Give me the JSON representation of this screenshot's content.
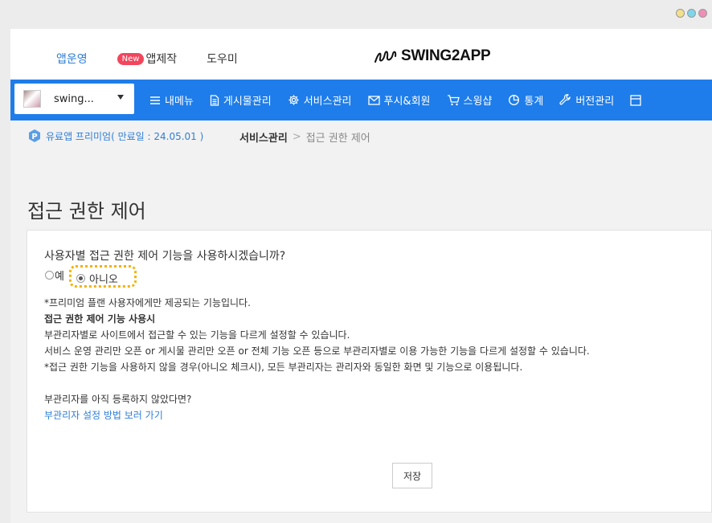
{
  "window": {
    "dots": [
      "#f3e08a",
      "#7fd6ea",
      "#ee8fb6"
    ]
  },
  "topnav": {
    "app_ops": "앱운영",
    "new_badge": "New",
    "app_make": "앱제작",
    "helper": "도우미"
  },
  "logo": {
    "text": "SWING2APP"
  },
  "bluebar": {
    "app_name": "swing...",
    "menu": [
      {
        "label": "내메뉴",
        "icon": "hamburger-icon"
      },
      {
        "label": "게시물관리",
        "icon": "document-icon"
      },
      {
        "label": "서비스관리",
        "icon": "gear-icon"
      },
      {
        "label": "푸시&회원",
        "icon": "mail-icon"
      },
      {
        "label": "스윙샵",
        "icon": "cart-icon"
      },
      {
        "label": "통계",
        "icon": "pie-chart-icon"
      },
      {
        "label": "버전관리",
        "icon": "wrench-icon"
      }
    ]
  },
  "breadcrumb": {
    "premium_text": "유료앱 프리미엄( 만료일 : 24.05.01 )",
    "section": "서비스관리",
    "separator": ">",
    "current": "접근 권한 제어"
  },
  "page": {
    "title": "접근 권한 제어"
  },
  "form": {
    "question": "사용자별 접근 권한 제어 기능을 사용하시겠습니까?",
    "option_yes": "예",
    "option_no": "아니오",
    "selected": "아니오",
    "notes": {
      "premium_only": "*프리미엄 플랜 사용자에게만 제공되는 기능입니다.",
      "heading": "접근 권한 제어 기능 사용시",
      "line1": "부관리자별로 사이트에서 접근할 수 있는 기능을 다르게 설정할 수 있습니다.",
      "line2": "서비스 운영 관리만 오픈 or 게시물 관리만 오픈 or 전체 기능 오픈 등으로 부관리자별로 이용 가능한 기능을 다르게 설정할 수 있습니다.",
      "line3": "*접근 권한 기능을 사용하지 않을 경우(아니오 체크시), 모든 부관리자는 관리자와 동일한 화면 및 기능으로 이용됩니다.",
      "sub_q": "부관리자를 아직 등록하지 않았다면?",
      "sub_link": "부관리자 설정 방법 보러 가기"
    },
    "save_label": "저장"
  },
  "colors": {
    "accent": "#1e7dea",
    "link": "#2f7fd6",
    "highlight": "#f2b300",
    "new_badge": "#f2465d"
  }
}
